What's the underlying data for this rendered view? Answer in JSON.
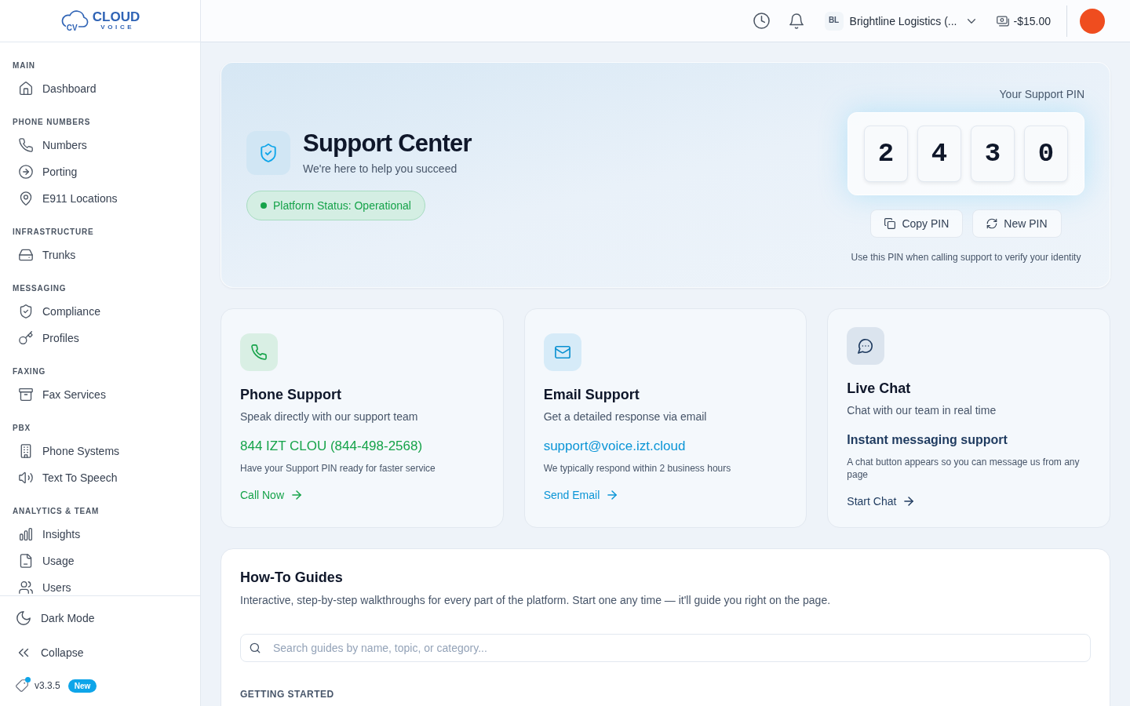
{
  "logo": {
    "initials": "CV",
    "name": "CLOUD",
    "tagline": "VOICE"
  },
  "sidebar": {
    "sections": [
      {
        "label": "MAIN",
        "items": [
          {
            "label": "Dashboard",
            "selected": false
          }
        ]
      },
      {
        "label": "PHONE NUMBERS",
        "items": [
          {
            "label": "Numbers",
            "selected": false
          },
          {
            "label": "Porting",
            "selected": false
          },
          {
            "label": "E911 Locations",
            "selected": false
          }
        ]
      },
      {
        "label": "INFRASTRUCTURE",
        "items": [
          {
            "label": "Trunks",
            "selected": false
          }
        ]
      },
      {
        "label": "MESSAGING",
        "items": [
          {
            "label": "Compliance",
            "selected": false
          },
          {
            "label": "Profiles",
            "selected": false
          }
        ]
      },
      {
        "label": "FAXING",
        "items": [
          {
            "label": "Fax Services",
            "selected": false
          }
        ]
      },
      {
        "label": "PBX",
        "items": [
          {
            "label": "Phone Systems",
            "selected": false
          },
          {
            "label": "Text To Speech",
            "selected": false
          }
        ]
      },
      {
        "label": "ANALYTICS & TEAM",
        "items": [
          {
            "label": "Insights",
            "selected": false
          },
          {
            "label": "Usage",
            "selected": false
          },
          {
            "label": "Users",
            "selected": false
          }
        ]
      }
    ],
    "footer": {
      "dark_mode": "Dark Mode",
      "collapse": "Collapse",
      "version": "v3.3.5",
      "new_label": "New",
      "update_dot": true
    }
  },
  "header": {
    "org": {
      "initials": "BL",
      "name": "Brightline Logistics (..."
    },
    "balance": "-$15.00"
  },
  "hero": {
    "title": "Support Center",
    "subtitle": "We're here to help you succeed",
    "status": {
      "kind": "operational",
      "text": "Platform Status: Operational"
    }
  },
  "pin": {
    "label": "Your Support PIN",
    "digits": [
      "2",
      "4",
      "3",
      "0"
    ],
    "buttons": [
      {
        "kind": "copy",
        "label": "Copy PIN"
      },
      {
        "kind": "refresh",
        "label": "New PIN"
      }
    ],
    "note": "Use this PIN when calling support to verify your identity"
  },
  "support_channels": [
    {
      "kind": "phone",
      "title": "Phone Support",
      "subtitle": "Speak directly with our support team",
      "contact": "844 IZT CLOU (844-498-2568)",
      "note": "Have your Support PIN ready for faster service",
      "action": "Call Now"
    },
    {
      "kind": "email",
      "title": "Email Support",
      "subtitle": "Get a detailed response via email",
      "contact": "support@voice.izt.cloud",
      "note": "We typically respond within 2 business hours",
      "action": "Send Email"
    },
    {
      "kind": "chat",
      "title": "Live Chat",
      "subtitle": "Chat with our team in real time",
      "contact": "Instant messaging support",
      "note": "A chat button appears so you can message us from any page",
      "action": "Start Chat"
    }
  ],
  "guides": {
    "title": "How-To Guides",
    "description": "Interactive, step-by-step walkthroughs for every part of the platform. Start one any time — it'll guide you right on the page.",
    "search": {
      "placeholder": "Search guides by name, topic, or category..."
    },
    "category": "GETTING STARTED"
  }
}
